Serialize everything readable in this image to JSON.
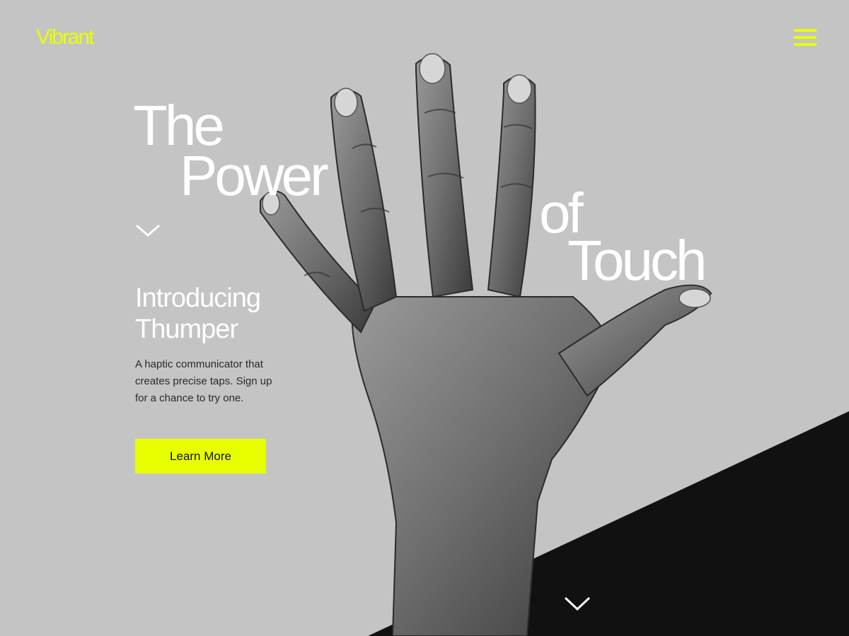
{
  "brand": {
    "name": "Vibrant",
    "accent": "#e8ff00"
  },
  "header": {
    "menu_icon": "hamburger-menu-icon"
  },
  "hero": {
    "headline_words": [
      "The",
      "Power",
      "of",
      "Touch"
    ],
    "scroll_icon": "chevron-down-icon",
    "product_heading_line1": "Introducing",
    "product_heading_line2": "Thumper",
    "description": "A haptic communicator that creates precise taps. Sign up for a chance to try one.",
    "cta_label": "Learn More"
  },
  "footer_band": {
    "color": "#111111",
    "scroll_icon": "chevron-down-icon"
  },
  "colors": {
    "background": "#c4c4c4",
    "text_light": "#ffffff",
    "text_dark": "#2a2a2a"
  }
}
